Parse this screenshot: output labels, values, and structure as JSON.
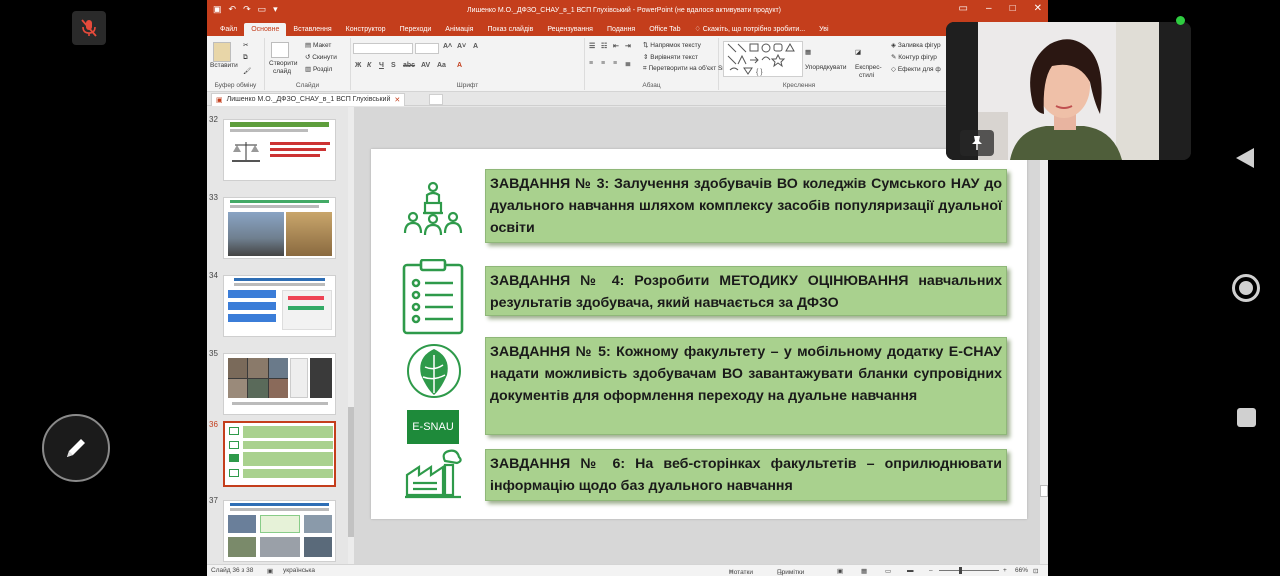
{
  "window": {
    "title": "Лишенко М.О._ДФЗО_СНАУ_в_1  ВСП Глухівський - PowerPoint (не вдалося активувати продукт)"
  },
  "ribbon_tabs": [
    {
      "label": "Файл",
      "active": false
    },
    {
      "label": "Основне",
      "active": true
    },
    {
      "label": "Вставлення",
      "active": false
    },
    {
      "label": "Конструктор",
      "active": false
    },
    {
      "label": "Переходи",
      "active": false
    },
    {
      "label": "Анімація",
      "active": false
    },
    {
      "label": "Показ слайдів",
      "active": false
    },
    {
      "label": "Рецензування",
      "active": false
    },
    {
      "label": "Подання",
      "active": false
    },
    {
      "label": "Office Tab",
      "active": false
    }
  ],
  "tell_me": "Скажіть, що потрібно зробити...",
  "tab_overflow": "Уві",
  "ribbon": {
    "paste": "Вставити",
    "new_slide_1": "Створити",
    "new_slide_2": "слайд",
    "layout": "Макет",
    "reset": "Скинути",
    "section": "Розділ",
    "text_direction": "Напрямок тексту",
    "align_text": "Вирівняти текст",
    "smartart": "Перетворити на об'єкт SmartArt",
    "arrange": "Упорядкувати",
    "quick_styles_1": "Експрес-",
    "quick_styles_2": "стилі",
    "shape_fill": "Заливка фігур",
    "shape_outline": "Контур фігур",
    "shape_effects": "Ефекти для ф",
    "group_clipboard": "Буфер обміну",
    "group_slides": "Слайди",
    "group_font": "Шрифт",
    "group_paragraph": "Абзац",
    "group_drawing": "Креслення"
  },
  "doc_tab": "Лишенко М.О._ДФЗО_СНАУ_в_1  ВСП Глухівський",
  "thumbnails": [
    {
      "num": "32",
      "selected": false
    },
    {
      "num": "33",
      "selected": false
    },
    {
      "num": "34",
      "selected": false
    },
    {
      "num": "35",
      "selected": false
    },
    {
      "num": "36",
      "selected": true
    },
    {
      "num": "37",
      "selected": false
    }
  ],
  "slide": {
    "tasks": [
      "ЗАВДАННЯ № 3: Залучення здобувачів ВО коледжів Сумського НАУ до дуального навчання шляхом комплексу засобів популяризації дуальної освіти",
      "ЗАВДАННЯ № 4: Розробити МЕТОДИКУ ОЦІНЮВАННЯ навчальних результатів здобувача, який навчається за ДФЗО",
      "ЗАВДАННЯ № 5: Кожному факультету – у мобільному додатку Е-СНАУ надати можливість здобувачам ВО завантажувати бланки супровідних документів для оформлення переходу на дуальне навчання",
      "ЗАВДАННЯ № 6: На веб-сторінках факультетів – оприлюднювати інформацію щодо баз дуального навчання"
    ],
    "esnau_label": "E-SNAU",
    "accent_color": "#a9d18e",
    "icon_color": "#2e9a4a"
  },
  "status": {
    "slide_counter": "Слайд 36 з 38",
    "language": "українська",
    "notes": "Нотатки",
    "comments": "Примітки",
    "zoom": "66%"
  },
  "icons": [
    "mic-off-icon",
    "pen-icon",
    "back-icon",
    "home-icon",
    "recent-apps-icon",
    "pin-icon",
    "teacher-audience-icon",
    "checklist-icon",
    "esnau-logo-icon",
    "factory-icon"
  ]
}
